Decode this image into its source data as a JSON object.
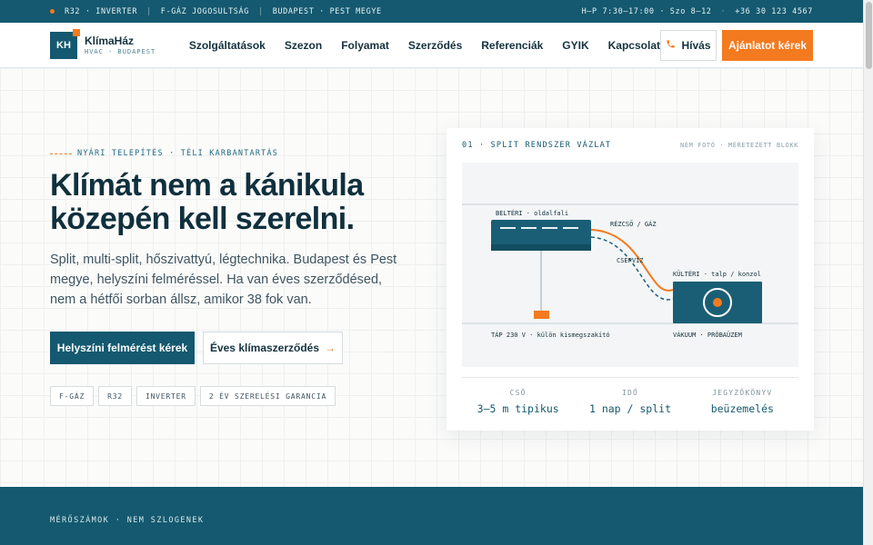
{
  "topbar": {
    "items": [
      "R32 · INVERTER",
      "F-GÁZ JOGOSULTSÁG",
      "BUDAPEST · PEST MEGYE"
    ],
    "hours": "H–P 7:30–17:00 · Szo 8–12",
    "phone": "+36 30 123 4567"
  },
  "nav": {
    "logo_mark": "KH",
    "brand": "KlímaHáz",
    "brand_sub": "HVAC · BUDAPEST",
    "menu": [
      "Szolgáltatások",
      "Szezon",
      "Folyamat",
      "Szerződés",
      "Referenciák",
      "GYIK",
      "Kapcsolat"
    ],
    "call_label": "Hívás",
    "quote_label": "Ajánlatot kérek"
  },
  "hero": {
    "eyebrow": "NYÁRI TELEPÍTÉS · TÉLI KARBANTARTÁS",
    "headline": "Klímát nem a kánikula közepén kell szerelni.",
    "lead": "Split, multi-split, hőszivattyú, légtechnika. Budapest és Pest megye, helyszíni felméréssel. Ha van éves szerződésed, nem a hétfői sorban állsz, amikor 38 fok van.",
    "primary_cta": "Helyszíni felmérést kérek",
    "secondary_cta": "Éves klímaszerződés",
    "tags": [
      "F-GÁZ",
      "R32",
      "INVERTER",
      "2 ÉV SZERELÉSI GARANCIA"
    ]
  },
  "diagram": {
    "title": "01 · SPLIT RENDSZER VÁZLAT",
    "note": "NEM FOTÓ · MÉRETEZETT BLOKK",
    "indoor_label": "BELTÉRI · oldalfali",
    "pipe_label": "RÉZCSŐ / GÁZ",
    "drain_label": "CSEPVÍZ",
    "outdoor_label": "KÜLTÉRI · talp / konzol",
    "power_label": "TÁP 230 V · külön kismegszakító",
    "vacuum_label": "VÁKUUM · PRÓBAÜZEM",
    "specs": [
      {
        "k": "CSŐ",
        "v": "3–5 m tipikus"
      },
      {
        "k": "IDŐ",
        "v": "1 nap / split"
      },
      {
        "k": "JEGYZŐKÖNYV",
        "v": "beüzemelés"
      }
    ]
  },
  "band": {
    "label": "MÉRŐSZÁMOK · NEM SZLOGENEK"
  },
  "colors": {
    "primary": "#14596f",
    "accent": "#f47a1f",
    "ink": "#10303d"
  }
}
